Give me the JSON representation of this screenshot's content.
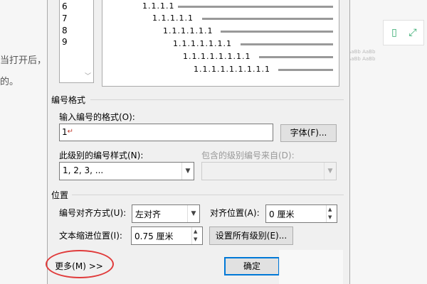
{
  "background": {
    "text_left_1": "当打开后，",
    "text_left_2": "的。"
  },
  "side_buttons": [
    {
      "icon": "phone-icon",
      "glyph": "▯"
    },
    {
      "icon": "expand-icon",
      "glyph": "⤢"
    }
  ],
  "level_list": {
    "items": [
      "6",
      "7",
      "8",
      "9"
    ],
    "scroll_glyph": "﹀"
  },
  "preview": {
    "rows": [
      "1.1.1.1",
      "1.1.1.1.1",
      "1.1.1.1.1.1",
      "1.1.1.1.1.1.1",
      "1.1.1.1.1.1.1.1",
      "1.1.1.1.1.1.1.1.1"
    ]
  },
  "number_format": {
    "section_title": "编号格式",
    "input_label": "输入编号的格式(O):",
    "input_value": "1",
    "font_button": "字体(F)...",
    "style_label": "此级别的编号样式(N):",
    "style_value": "1, 2, 3, ...",
    "include_label": "包含的级别编号来自(D):",
    "include_value": ""
  },
  "position": {
    "section_title": "位置",
    "align_label": "编号对齐方式(U):",
    "align_value": "左对齐",
    "at_label": "对齐位置(A):",
    "at_value": "0 厘米",
    "indent_label": "文本缩进位置(I):",
    "indent_value": "0.75 厘米",
    "set_all_button": "设置所有级别(E)..."
  },
  "footer": {
    "more_button": "更多(M) >>",
    "ok_button": "确定"
  },
  "colors": {
    "highlight_circle": "#e03a3a",
    "side_icon": "#2fa86b"
  }
}
